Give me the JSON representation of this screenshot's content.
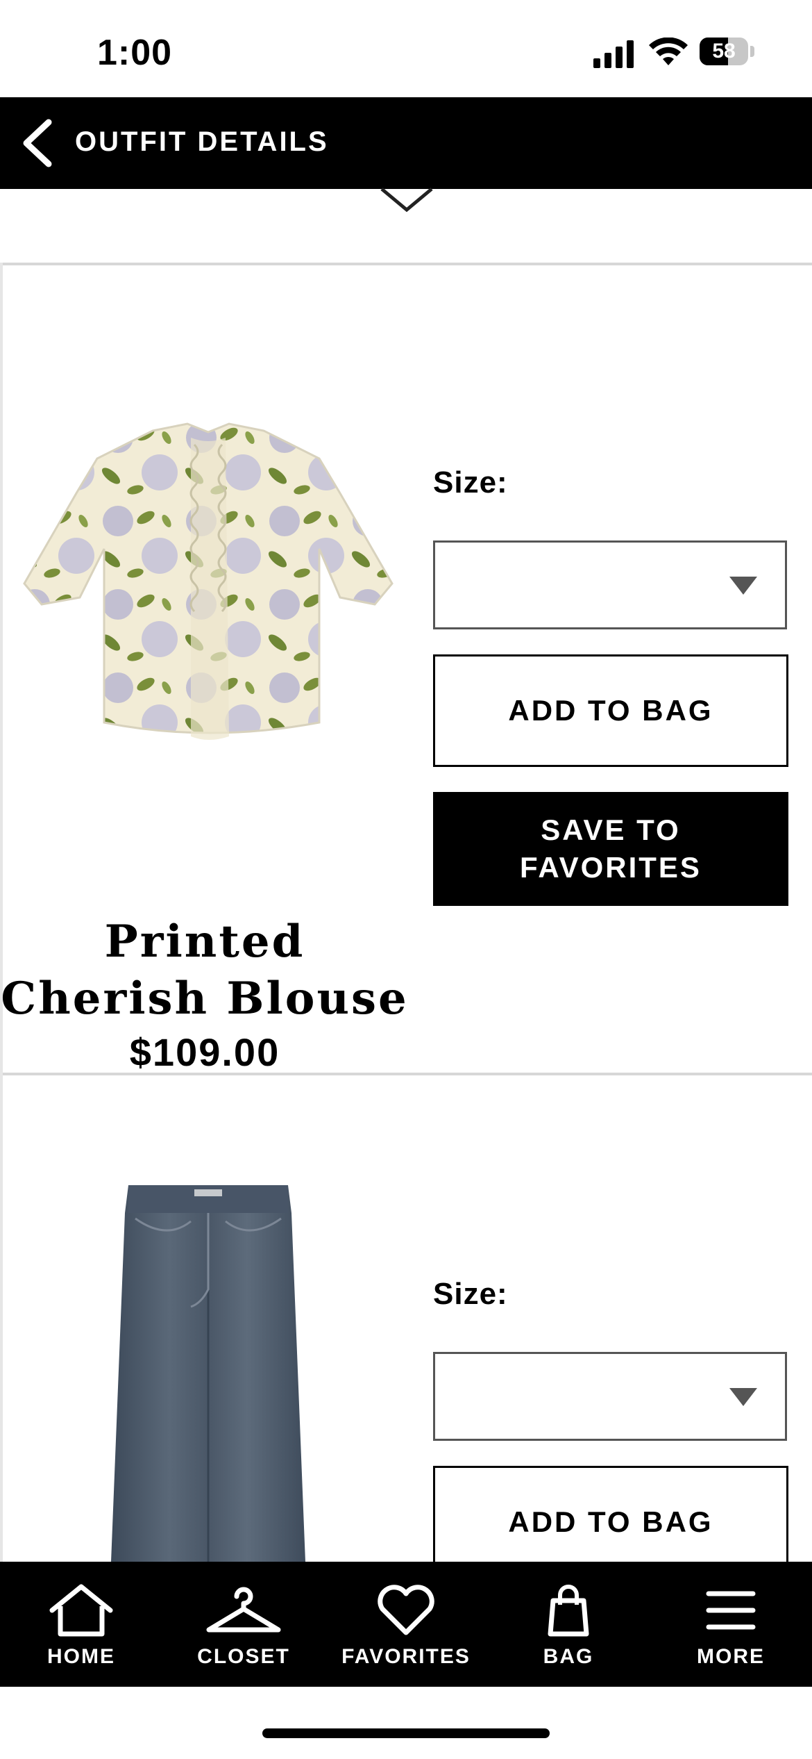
{
  "status_bar": {
    "time": "1:00",
    "battery": "58",
    "battery_level": 0.58
  },
  "header": {
    "title": "OUTFIT DETAILS"
  },
  "items": [
    {
      "name": "Printed Cherish Blouse",
      "price": "$109.00",
      "size_label": "Size:",
      "size_value": "",
      "add_to_bag": "ADD TO BAG",
      "save_to_favorites": "SAVE TO\nFAVORITES"
    },
    {
      "name": "",
      "price": "",
      "size_label": "Size:",
      "size_value": "",
      "add_to_bag": "ADD TO BAG"
    }
  ],
  "tabbar": {
    "items": [
      {
        "label": "HOME",
        "icon": "home-icon"
      },
      {
        "label": "CLOSET",
        "icon": "hanger-icon"
      },
      {
        "label": "FAVORITES",
        "icon": "heart-icon"
      },
      {
        "label": "BAG",
        "icon": "bag-icon"
      },
      {
        "label": "MORE",
        "icon": "menu-icon"
      }
    ]
  },
  "colors": {
    "accent": "#000000",
    "divider": "#d7d7d7",
    "blouse_leaf": "#7a8f3a",
    "blouse_flower": "#b7b4cf",
    "denim": "#4c5a6b"
  }
}
